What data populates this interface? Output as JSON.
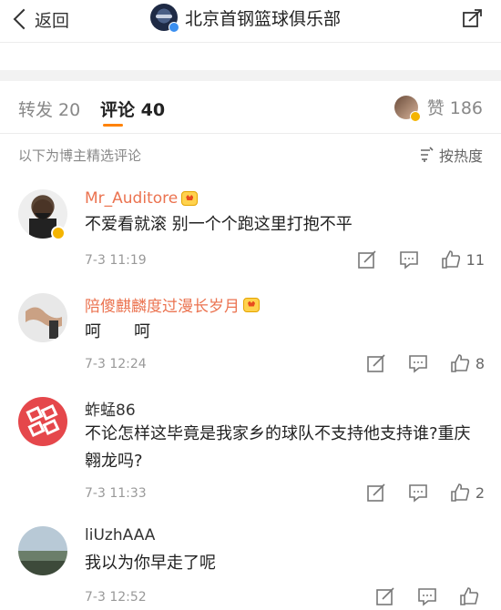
{
  "nav": {
    "back_label": "返回",
    "title": "北京首钢篮球俱乐部"
  },
  "tabs": {
    "repost_label": "转发 20",
    "comments_label": "评论 40",
    "likes_label": "赞 186"
  },
  "section": {
    "note": "以下为博主精选评论",
    "sort_label": "按热度"
  },
  "comments": [
    {
      "name": "Mr_Auditore",
      "text": "不爱看就滚 别一个个跑这里打抱不平",
      "time": "7-3 11:19",
      "likes": "11"
    },
    {
      "name": "陪傻麒麟度过漫长岁月",
      "text": "呵　　呵",
      "time": "7-3 12:24",
      "likes": "8"
    },
    {
      "name": "蚱蜢86",
      "text": "不论怎样这毕竟是我家乡的球队不支持他支持谁?重庆翱龙吗?",
      "time": "7-3 11:33",
      "likes": "2"
    },
    {
      "name": "liUzhAAA",
      "text": "我以为你早走了呢",
      "time": "7-3 12:52",
      "likes": ""
    }
  ],
  "colors": {
    "accent": "#ff8200",
    "vip_name": "#eb7350",
    "gold_badge": "#f4b400"
  }
}
